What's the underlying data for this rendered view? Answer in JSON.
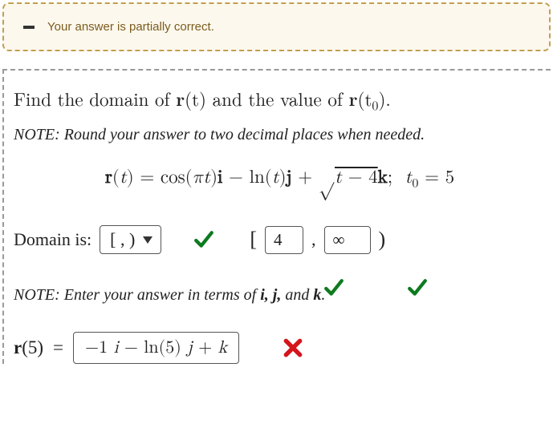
{
  "feedback": {
    "message": "Your answer is partially correct."
  },
  "question": {
    "prompt_prefix": "Find the domain of ",
    "prompt_r": "r",
    "prompt_paren1": "(t)",
    "prompt_mid": " and the value of ",
    "prompt_r2": "r",
    "prompt_paren2": "(t",
    "prompt_sub": "0",
    "prompt_close": ").",
    "note": "NOTE:  Round your answer to two decimal places when needed.",
    "equation": "r(t) = cos(πt)i − ln(t)j + √(t − 4)k;  t₀ = 5"
  },
  "domain": {
    "label": "Domain is:",
    "dropdown_value": "[ ,  )",
    "bracket_open": "[",
    "lower_value": "4",
    "comma": ",",
    "upper_value": "∞",
    "bracket_close": ")"
  },
  "note2": {
    "prefix": "NOTE:  Enter your answer in terms of ",
    "ijk": "i, j,",
    "and": " and ",
    "k": "k",
    "period": "."
  },
  "answer": {
    "lhs_r": "r",
    "lhs_arg": "(5)",
    "equals": "=",
    "value": "−1 i − ln(5) j + k"
  }
}
